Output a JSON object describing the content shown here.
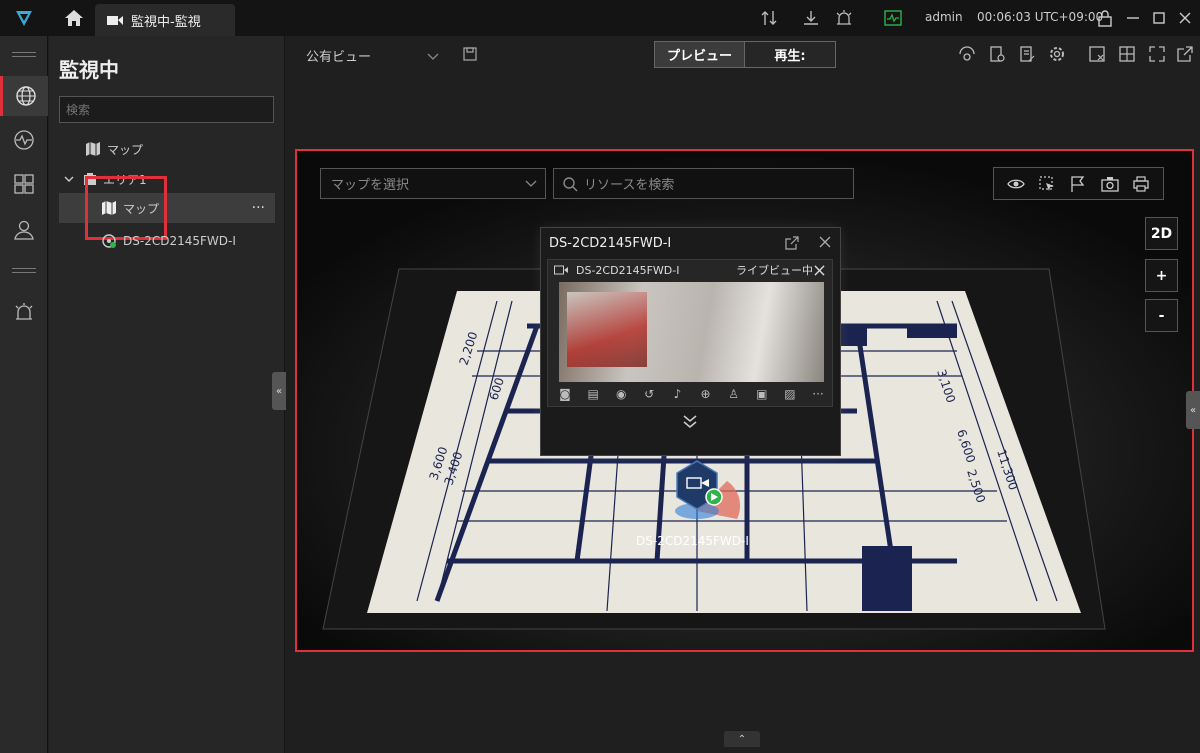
{
  "titlebar": {
    "tab_label": "監視中-監視",
    "user": "admin",
    "clock": "00:06:03 UTC+09:00"
  },
  "panel": {
    "title": "監視中",
    "search_placeholder": "検索",
    "tree": {
      "map_root": "マップ",
      "area": "エリア1",
      "map_child": "マップ",
      "camera": "DS-2CD2145FWD-I"
    }
  },
  "toolbar": {
    "view_name": "公有ビュー",
    "preview_label": "プレビュー",
    "playback_label": "再生:"
  },
  "map": {
    "select_placeholder": "マップを選択",
    "search_placeholder": "リソースを検索",
    "btn_2d": "2D",
    "zoom_in": "+",
    "zoom_out": "-",
    "camera_label": "DS-2CD2145FWD-I",
    "dims": [
      "2,200",
      "600",
      "3,400",
      "3,600",
      "3,100",
      "6,600",
      "2,500",
      "11,300"
    ]
  },
  "popup": {
    "title": "DS-2CD2145FWD-I",
    "camera_name": "DS-2CD2145FWD-I",
    "status": "ライブビュー中",
    "more": "···"
  },
  "colors": {
    "accent_red": "#e0303a",
    "logo": "#3aa9d6",
    "plan_paper": "#e9e6de",
    "plan_ink": "#1b2450",
    "status_green": "#2fb34a"
  }
}
